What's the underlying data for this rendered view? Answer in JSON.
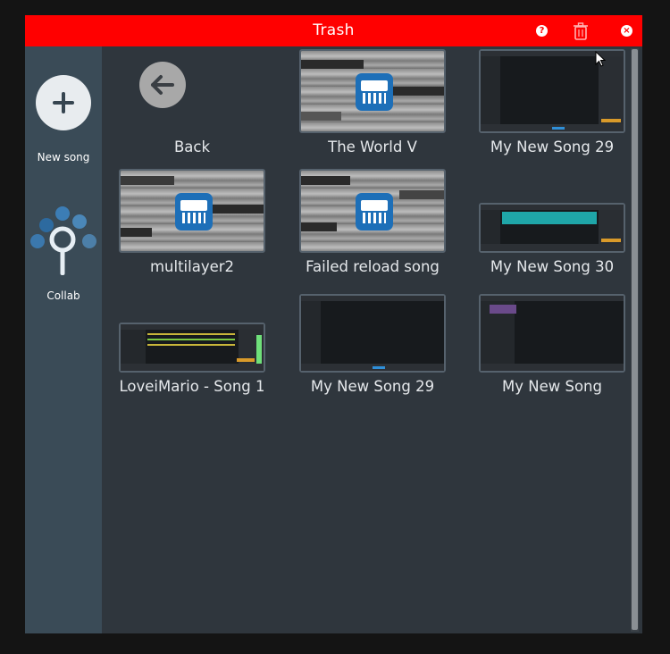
{
  "window": {
    "title": "Trash",
    "help_label": "?",
    "close_label": "×",
    "colors": {
      "titlebar": "#ff0000",
      "background": "#2f363d",
      "sidebar": "#3a4b57"
    }
  },
  "sidebar": {
    "new_song_label": "New song",
    "collab_label": "Collab"
  },
  "tiles": [
    {
      "label": "Back",
      "thumb": "back-arrow"
    },
    {
      "label": "The World V",
      "thumb": "gray-app-icon"
    },
    {
      "label": "My New Song 29",
      "thumb": "screenshot-dark"
    },
    {
      "label": "multilayer2",
      "thumb": "gray-app-icon"
    },
    {
      "label": "Failed reload song",
      "thumb": "gray-app-icon"
    },
    {
      "label": "My New Song 30",
      "thumb": "screenshot-teal"
    },
    {
      "label": "LoveiMario - Song 1",
      "thumb": "screenshot-tracks"
    },
    {
      "label": "My New Song 29",
      "thumb": "screenshot-dark"
    },
    {
      "label": "My New Song",
      "thumb": "screenshot-purple"
    }
  ]
}
